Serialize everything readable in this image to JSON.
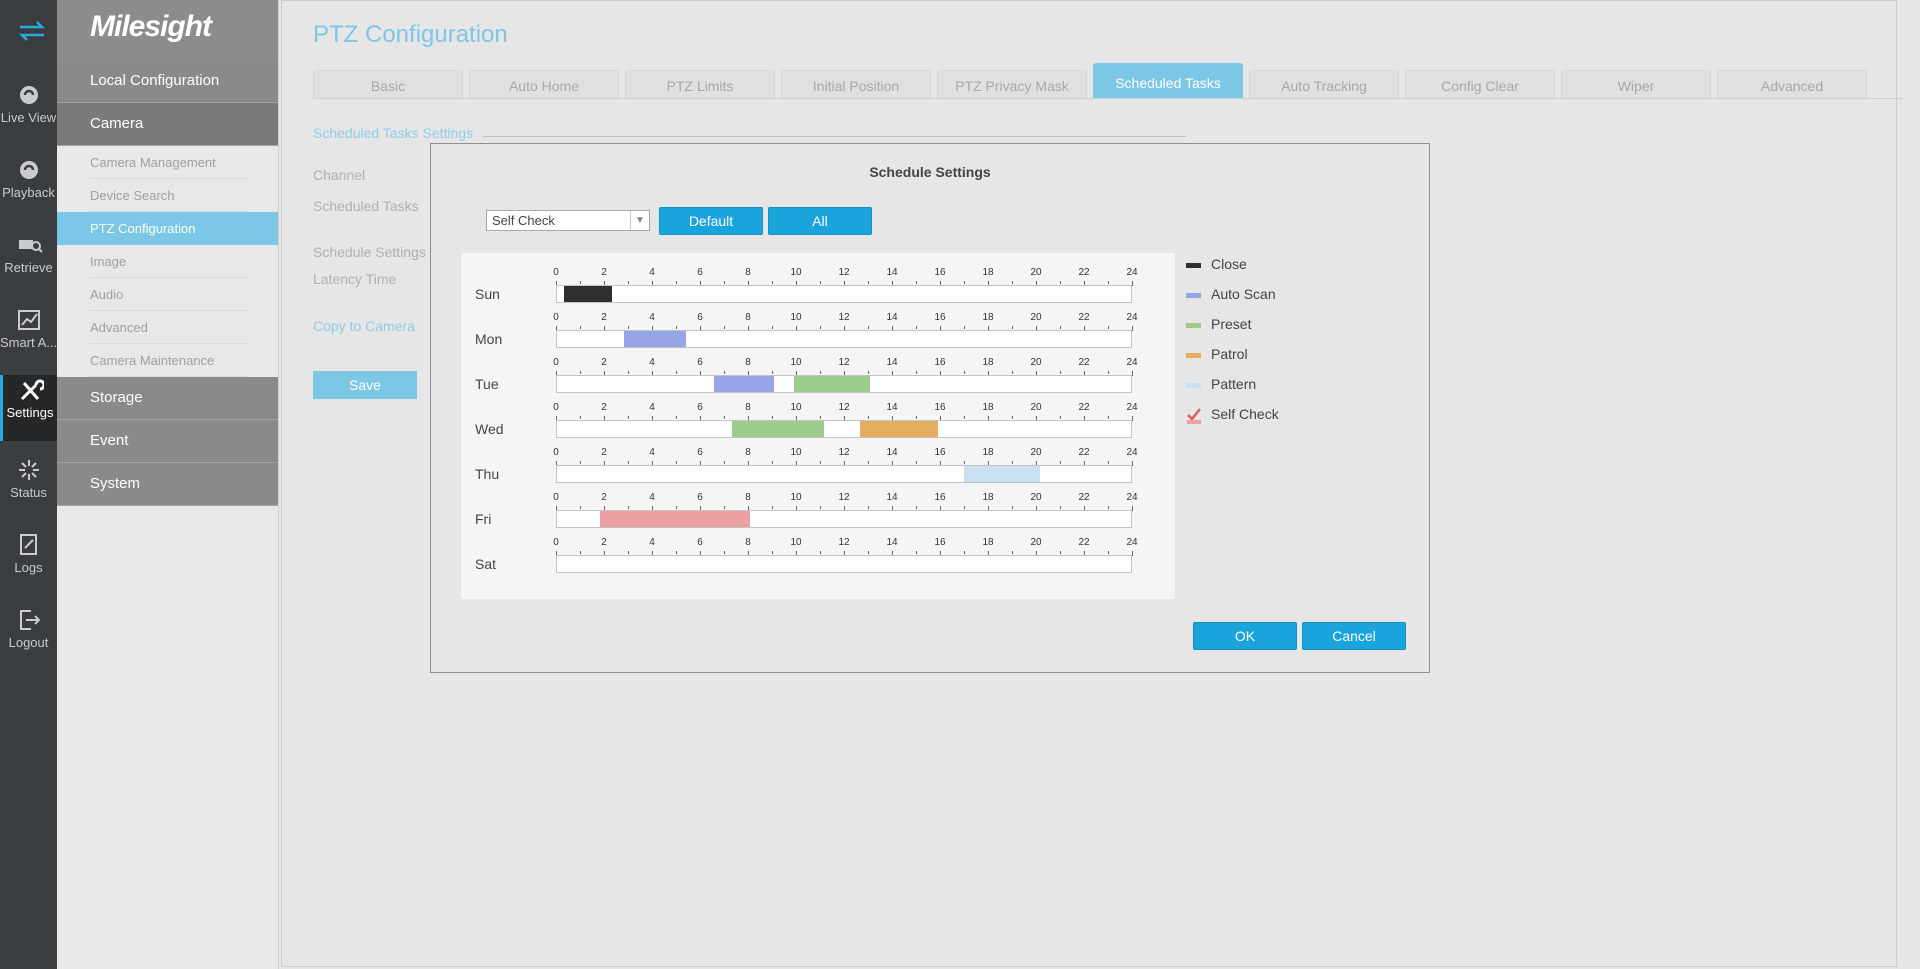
{
  "rail": [
    {
      "label": "",
      "icon": "switch-arrows-icon",
      "active": false
    },
    {
      "label": "Live View",
      "icon": "live-view-icon",
      "active": false
    },
    {
      "label": "Playback",
      "icon": "playback-icon",
      "active": false
    },
    {
      "label": "Retrieve",
      "icon": "retrieve-icon",
      "active": false
    },
    {
      "label": "Smart A...",
      "icon": "smart-analytics-icon",
      "active": false
    },
    {
      "label": "Settings",
      "icon": "settings-icon",
      "active": true
    },
    {
      "label": "Status",
      "icon": "status-icon",
      "active": false
    },
    {
      "label": "Logs",
      "icon": "logs-icon",
      "active": false
    },
    {
      "label": "Logout",
      "icon": "logout-icon",
      "active": false
    }
  ],
  "sidebar": {
    "logo": "Milesight",
    "local_configuration": "Local Configuration",
    "camera": "Camera",
    "camera_items": [
      "Camera Management",
      "Device Search",
      "PTZ Configuration",
      "Image",
      "Audio",
      "Advanced",
      "Camera Maintenance"
    ],
    "active_item": "PTZ Configuration",
    "storage": "Storage",
    "event": "Event",
    "system": "System"
  },
  "main": {
    "title": "PTZ Configuration",
    "tabs": [
      "Basic",
      "Auto Home",
      "PTZ Limits",
      "Initial Position",
      "PTZ Privacy Mask",
      "Scheduled Tasks",
      "Auto Tracking",
      "Config Clear",
      "Wiper",
      "Advanced"
    ],
    "active_tab": "Scheduled Tasks",
    "section_title": "Scheduled Tasks Settings",
    "labels": {
      "channel": "Channel",
      "scheduled_tasks": "Scheduled Tasks",
      "schedule_settings": "Schedule Settings",
      "latency_time": "Latency Time"
    },
    "copy_to_camera": "Copy to Camera",
    "save": "Save"
  },
  "dialog": {
    "title": "Schedule Settings",
    "task_select": "Self Check",
    "default_button": "Default",
    "all_button": "All",
    "ok": "OK",
    "cancel": "Cancel",
    "hours": [
      "0",
      "2",
      "4",
      "6",
      "8",
      "10",
      "12",
      "14",
      "16",
      "18",
      "20",
      "22",
      "24"
    ],
    "days": [
      {
        "name": "Sun",
        "segments": [
          {
            "start": 0.33,
            "end": 2.33,
            "task": "Close"
          }
        ]
      },
      {
        "name": "Mon",
        "segments": [
          {
            "start": 2.83,
            "end": 5.42,
            "task": "Auto Scan"
          }
        ]
      },
      {
        "name": "Tue",
        "segments": [
          {
            "start": 6.58,
            "end": 9.08,
            "task": "Auto Scan"
          },
          {
            "start": 9.92,
            "end": 13.08,
            "task": "Preset"
          }
        ]
      },
      {
        "name": "Wed",
        "segments": [
          {
            "start": 7.33,
            "end": 11.17,
            "task": "Preset"
          },
          {
            "start": 12.67,
            "end": 15.92,
            "task": "Patrol"
          }
        ]
      },
      {
        "name": "Thu",
        "segments": [
          {
            "start": 17,
            "end": 20.17,
            "task": "Pattern"
          }
        ]
      },
      {
        "name": "Fri",
        "segments": [
          {
            "start": 1.83,
            "end": 8.08,
            "task": "Self Check"
          }
        ]
      },
      {
        "name": "Sat",
        "segments": []
      }
    ],
    "legend": [
      {
        "label": "Close",
        "color": "#2f2f2f"
      },
      {
        "label": "Auto Scan",
        "color": "#95a5e6"
      },
      {
        "label": "Preset",
        "color": "#9ccb8c"
      },
      {
        "label": "Patrol",
        "color": "#e5ae5e"
      },
      {
        "label": "Pattern",
        "color": "#c7e1f3"
      },
      {
        "label": "Self Check",
        "color": "#eda0a3"
      }
    ]
  }
}
